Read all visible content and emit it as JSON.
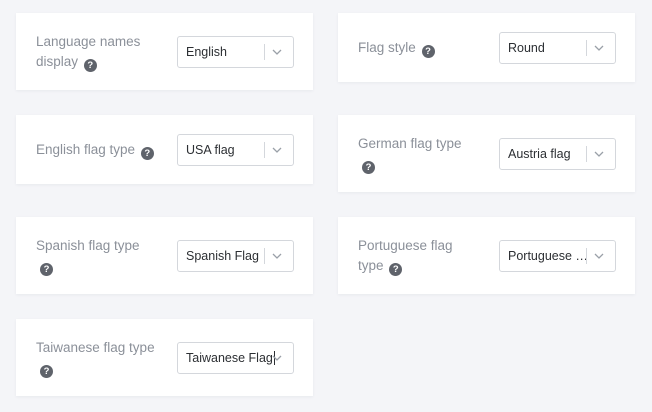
{
  "settings": [
    {
      "id": "language-names-display",
      "label_line1": "Language names",
      "label_line2": "display",
      "help_icon": "question-circle-icon",
      "value": "English"
    },
    {
      "id": "flag-style",
      "label_line1": "Flag style",
      "label_line2": "",
      "help_icon": "question-circle-icon",
      "value": "Round"
    },
    {
      "id": "english-flag-type",
      "label_line1": "English flag type",
      "label_line2": "",
      "help_icon": "question-circle-icon",
      "value": "USA flag"
    },
    {
      "id": "german-flag-type",
      "label_line1": "German flag type",
      "label_line2": "",
      "help_icon": "question-circle-icon",
      "value": "Austria flag"
    },
    {
      "id": "spanish-flag-type",
      "label_line1": "Spanish flag type",
      "label_line2": "",
      "help_icon": "question-circle-icon",
      "value": "Spanish Flag"
    },
    {
      "id": "portuguese-flag-type",
      "label_line1": "Portuguese flag",
      "label_line2": "type",
      "help_icon": "question-circle-icon",
      "value": "Portuguese Fl..."
    },
    {
      "id": "taiwanese-flag-type",
      "label_line1": "Taiwanese flag type",
      "label_line2": "",
      "help_icon": "question-circle-icon",
      "value": "Taiwanese Flag"
    }
  ],
  "help_glyph": "?",
  "colors": {
    "background": "#f4f5f8",
    "card": "#ffffff",
    "label": "#8b9099",
    "help_icon": "#5f636b",
    "border": "#d4d7dc"
  }
}
